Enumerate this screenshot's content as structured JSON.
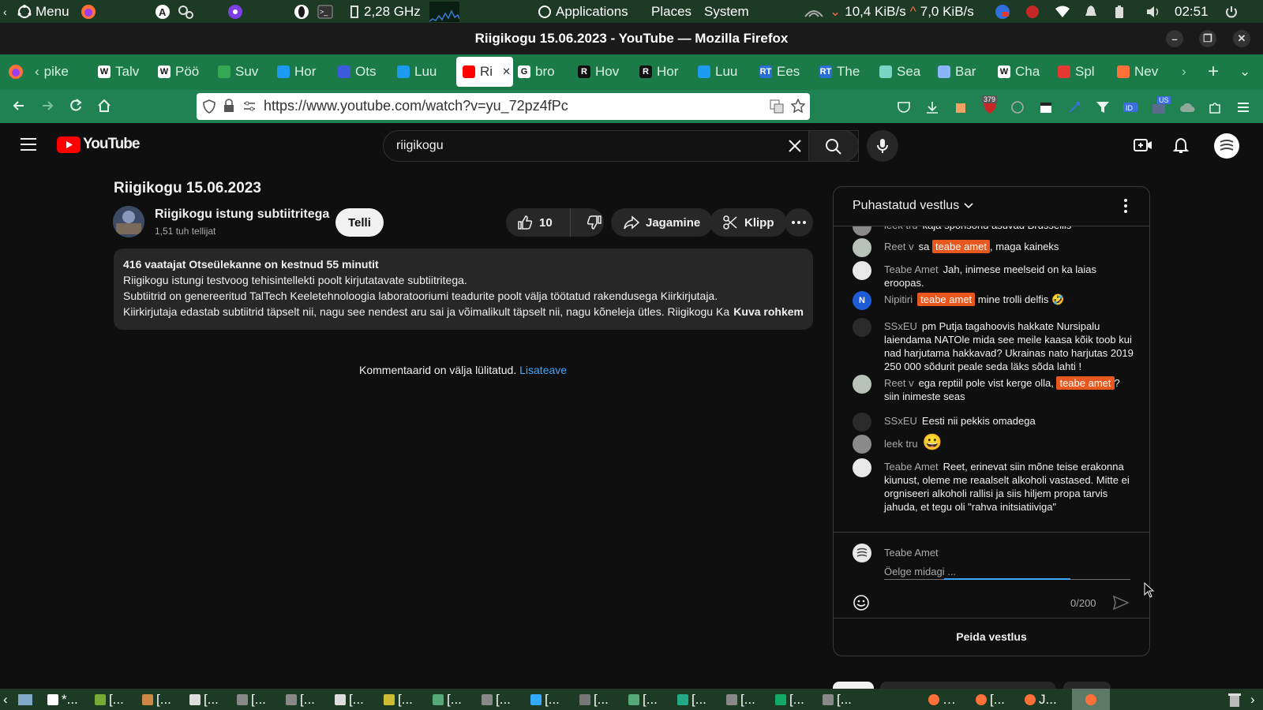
{
  "system_panel": {
    "menu_label": "Menu",
    "cpu_freq": "2,28 GHz",
    "applications": "Applications",
    "places": "Places",
    "system": "System",
    "net_down": "10,4 KiB/s",
    "net_up": "7,0 KiB/s",
    "clock": "02:51"
  },
  "window": {
    "title": "Riigikogu 15.06.2023 - YouTube — Mozilla Firefox"
  },
  "tabs": [
    {
      "label": "pike",
      "color": "#1a7a48",
      "glyph": ""
    },
    {
      "label": "Talv",
      "color": "#ffffff",
      "glyph": "W"
    },
    {
      "label": "Pöö",
      "color": "#ffffff",
      "glyph": "W"
    },
    {
      "label": "Suv",
      "color": "#34a853",
      "glyph": ""
    },
    {
      "label": "Hor",
      "color": "#1d9bf0",
      "glyph": ""
    },
    {
      "label": "Ots",
      "color": "#3b5bdb",
      "glyph": ""
    },
    {
      "label": "Luu",
      "color": "#1d9bf0",
      "glyph": ""
    },
    {
      "label": "Ri",
      "color": "#ff0000",
      "glyph": ""
    },
    {
      "label": "bro",
      "color": "#ffffff",
      "glyph": "G"
    },
    {
      "label": "Hov",
      "color": "#111111",
      "glyph": "R"
    },
    {
      "label": "Hor",
      "color": "#111111",
      "glyph": "R"
    },
    {
      "label": "Luu",
      "color": "#1d9bf0",
      "glyph": ""
    },
    {
      "label": "Ees",
      "color": "#2a6fd6",
      "glyph": "RT"
    },
    {
      "label": "The",
      "color": "#2a6fd6",
      "glyph": "RT"
    },
    {
      "label": "Sea",
      "color": "#7bd3c4",
      "glyph": ""
    },
    {
      "label": "Bar",
      "color": "#8ab4f8",
      "glyph": ""
    },
    {
      "label": "Cha",
      "color": "#ffffff",
      "glyph": "W"
    },
    {
      "label": "Spl",
      "color": "#e53935",
      "glyph": ""
    },
    {
      "label": "Nev",
      "color": "#ff7139",
      "glyph": ""
    }
  ],
  "navbar": {
    "url": "https://www.youtube.com/watch?v=yu_72pz4fPc",
    "badge_count": "379",
    "us_badge": "US"
  },
  "youtube": {
    "logo_text": "YouTube",
    "search_value": "riigikogu",
    "video_title": "Riigikogu 15.06.2023",
    "channel_name": "Riigikogu istung subtiitritega",
    "subscribers": "1,51 tuh tellijat",
    "subscribe_label": "Telli",
    "like_count": "10",
    "share_label": "Jagamine",
    "clip_label": "Klipp",
    "desc_stats": "416 vaatajat  Otseülekanne on kestnud 55 minutit",
    "desc_line1": "Riigikogu istungi testvoog tehisintellekti poolt kirjutatavate subtiitritega.",
    "desc_line2": "Subtiitrid on genereeritud TalTech Keeletehnoloogia laboratooriumi teadurite poolt välja töötatud rakendusega Kiirkirjutaja.",
    "desc_line3": "Kiirkirjutaja edastab subtiitrid täpselt nii, nagu see nendest aru sai ja võimalikult täpselt nii, nagu kõneleja ütles. Riigikogu Kan",
    "more_label": "Kuva rohkem",
    "comments_off": "Kommentaarid on välja lülitatud.",
    "learn_more": "Lisateave"
  },
  "chat": {
    "title": "Puhastatud vestlus",
    "top_partial_author": "leek tru",
    "top_partial_text": "kaja sponsorid asuvad Brussellis",
    "messages": [
      {
        "author": "Reet v",
        "pre": "sa",
        "badge": "teabe amet",
        "post": ", maga kaineks",
        "avatar_color": "#b7c2b8",
        "avatar_text": ""
      },
      {
        "author": "Teabe Amet",
        "pre": "Jah, inimese meelseid on ka laias eroopas.",
        "badge": "",
        "post": "",
        "avatar_color": "#e8e8e8",
        "avatar_text": ""
      },
      {
        "author": "Nipitiri",
        "pre": "",
        "badge": "teabe amet",
        "post": "mine trolli delfis 🤣",
        "avatar_color": "#1e5bd6",
        "avatar_text": "N"
      },
      {
        "author": "SSxEU",
        "pre": "pm Putja tagahoovis hakkate Nursipalu laiendama NATOle mida see meile kaasa kõik toob kui nad harjutama hakkavad? Ukrainas nato harjutas 2019 250 000 sõdurit peale seda läks sõda lahti !",
        "badge": "",
        "post": "",
        "avatar_color": "#2a2a2a",
        "avatar_text": ""
      },
      {
        "author": "Reet v",
        "pre": "ega reptiil pole vist kerge olla,",
        "badge": "teabe amet",
        "post": "? siin inimeste seas",
        "avatar_color": "#b7c2b8",
        "avatar_text": ""
      },
      {
        "author": "SSxEU",
        "pre": "Eesti nii pekkis omadega",
        "badge": "",
        "post": "",
        "avatar_color": "#2a2a2a",
        "avatar_text": ""
      },
      {
        "author": "leek tru",
        "pre": "😀",
        "badge": "",
        "post": "",
        "avatar_color": "#8a8a8a",
        "avatar_text": ""
      },
      {
        "author": "Teabe Amet",
        "pre": "Reet, erinevat siin mõne teise erakonna kiunust, oleme me reaalselt alkoholi vastased. Mitte ei orgniseeri alkoholi rallisi ja siis hiljem propa tarvis jahuda, et tegu oli \"rahva initsiatiiviga\"",
        "badge": "",
        "post": "",
        "avatar_color": "#e8e8e8",
        "avatar_text": ""
      }
    ],
    "input_author": "Teabe Amet",
    "input_placeholder": "Öelge midagi ...",
    "char_count": "0/200",
    "hide_chat": "Peida vestlus"
  },
  "taskbar": {
    "items": [
      "*...",
      "[...",
      "[...",
      "[...",
      "[...",
      "[...",
      "[...",
      "[...",
      "[...",
      "[...",
      "[...",
      "[...",
      "[...",
      "[...",
      "[...",
      "[...",
      "[...",
      "…",
      "[...",
      "J..."
    ]
  }
}
